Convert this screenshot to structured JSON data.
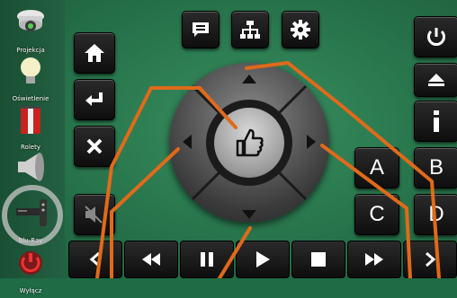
{
  "sidebar": {
    "items": [
      {
        "label": "Projekcja",
        "icon": "projector-icon"
      },
      {
        "label": "Oświetlenie",
        "icon": "bulb-icon"
      },
      {
        "label": "Rolety",
        "icon": "blinds-icon"
      },
      {
        "label": "",
        "icon": "speaker-icon"
      },
      {
        "label": "Blu-Ray",
        "icon": "bluray-player-icon"
      },
      {
        "label": "Wyłącz",
        "icon": "power-off-icon"
      }
    ]
  },
  "top_toolbar": [
    "message-icon",
    "network-icon",
    "gear-icon"
  ],
  "left_controls": [
    "home-icon",
    "enter-icon",
    "close-icon",
    "mute-icon"
  ],
  "right_controls": {
    "icons": [
      "power-icon",
      "eject-icon",
      "info-icon"
    ],
    "letters": [
      "A",
      "B",
      "C",
      "D"
    ]
  },
  "transport": [
    "chevron-left-icon",
    "rewind-icon",
    "pause-icon",
    "play-icon",
    "stop-icon",
    "fast-forward-icon",
    "chevron-right-icon"
  ],
  "colors": {
    "background": "#2b7a50",
    "button": "#141414",
    "annotation": "#e06a1a",
    "highlight": "#c8c8c8"
  }
}
